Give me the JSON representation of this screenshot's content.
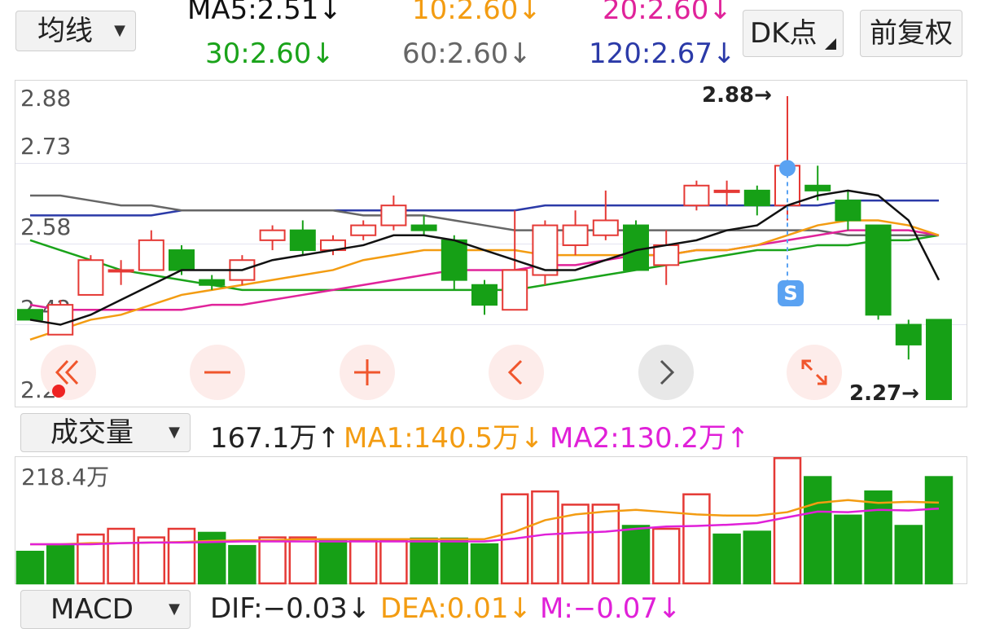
{
  "top": {
    "avg_select": "均线",
    "dk_button": "DK点",
    "fq_button": "前复权",
    "ma5": "MA5:2.51",
    "ma10": "10:2.60",
    "ma20": "20:2.60",
    "ma30": "30:2.60",
    "ma60": "60:2.60",
    "ma120": "120:2.67",
    "arrow_down": "↓"
  },
  "kline": {
    "y_labels": [
      "2.88",
      "2.73",
      "2.58",
      "2.42",
      "2.27"
    ],
    "high_label": "2.88→",
    "low_label": "→2.27",
    "low_value": "2.27",
    "low_arrow": "→",
    "signal_badge": "S"
  },
  "volume": {
    "select": "成交量",
    "value": "167.1万",
    "ma1": "MA1:140.5万",
    "ma2": "MA2:130.2万",
    "max_label": "218.4万",
    "arrow_up": "↑",
    "arrow_down": "↓"
  },
  "macd": {
    "select": "MACD",
    "dif": "DIF:−0.03",
    "dea": "DEA:0.01",
    "m": "M:−0.07",
    "arrow_down": "↓"
  },
  "colors": {
    "up": "#e53935",
    "down": "#16a016",
    "ma5": "#111111",
    "ma10": "#f39c12",
    "ma20": "#e0239a",
    "ma30": "#1aa31a",
    "ma60": "#666666",
    "ma120": "#2b3aa8",
    "ctrl_bg": "#fdecea",
    "ctrl_fg": "#f0552c"
  },
  "chart_data": [
    {
      "type": "candlestick",
      "ylim": [
        2.27,
        2.88
      ],
      "candles": [
        {
          "o": 2.45,
          "c": 2.43,
          "h": 2.45,
          "l": 2.43
        },
        {
          "o": 2.4,
          "c": 2.46,
          "h": 2.47,
          "l": 2.4
        },
        {
          "o": 2.48,
          "c": 2.55,
          "h": 2.56,
          "l": 2.48
        },
        {
          "o": 2.53,
          "c": 2.53,
          "h": 2.55,
          "l": 2.5
        },
        {
          "o": 2.53,
          "c": 2.59,
          "h": 2.61,
          "l": 2.53
        },
        {
          "o": 2.57,
          "c": 2.53,
          "h": 2.58,
          "l": 2.52
        },
        {
          "o": 2.51,
          "c": 2.5,
          "h": 2.52,
          "l": 2.49
        },
        {
          "o": 2.51,
          "c": 2.55,
          "h": 2.56,
          "l": 2.5
        },
        {
          "o": 2.59,
          "c": 2.61,
          "h": 2.62,
          "l": 2.57
        },
        {
          "o": 2.61,
          "c": 2.57,
          "h": 2.63,
          "l": 2.56
        },
        {
          "o": 2.57,
          "c": 2.59,
          "h": 2.6,
          "l": 2.56
        },
        {
          "o": 2.6,
          "c": 2.62,
          "h": 2.63,
          "l": 2.59
        },
        {
          "o": 2.62,
          "c": 2.66,
          "h": 2.68,
          "l": 2.61
        },
        {
          "o": 2.62,
          "c": 2.61,
          "h": 2.64,
          "l": 2.6
        },
        {
          "o": 2.59,
          "c": 2.51,
          "h": 2.6,
          "l": 2.49
        },
        {
          "o": 2.5,
          "c": 2.46,
          "h": 2.51,
          "l": 2.44
        },
        {
          "o": 2.45,
          "c": 2.53,
          "h": 2.65,
          "l": 2.45
        },
        {
          "o": 2.52,
          "c": 2.62,
          "h": 2.63,
          "l": 2.5
        },
        {
          "o": 2.58,
          "c": 2.62,
          "h": 2.65,
          "l": 2.56
        },
        {
          "o": 2.6,
          "c": 2.63,
          "h": 2.69,
          "l": 2.59
        },
        {
          "o": 2.62,
          "c": 2.53,
          "h": 2.63,
          "l": 2.53
        },
        {
          "o": 2.54,
          "c": 2.58,
          "h": 2.61,
          "l": 2.5
        },
        {
          "o": 2.66,
          "c": 2.7,
          "h": 2.71,
          "l": 2.65
        },
        {
          "o": 2.69,
          "c": 2.69,
          "h": 2.71,
          "l": 2.66
        },
        {
          "o": 2.69,
          "c": 2.66,
          "h": 2.7,
          "l": 2.64
        },
        {
          "o": 2.66,
          "c": 2.74,
          "h": 2.88,
          "l": 2.63
        },
        {
          "o": 2.7,
          "c": 2.69,
          "h": 2.74,
          "l": 2.67
        },
        {
          "o": 2.67,
          "c": 2.63,
          "h": 2.69,
          "l": 2.61
        },
        {
          "o": 2.62,
          "c": 2.44,
          "h": 2.62,
          "l": 2.43
        },
        {
          "o": 2.42,
          "c": 2.38,
          "h": 2.43,
          "l": 2.35
        },
        {
          "o": 2.43,
          "c": 2.27,
          "h": 2.43,
          "l": 2.27
        }
      ],
      "ma5": [
        2.43,
        2.42,
        2.44,
        2.47,
        2.5,
        2.53,
        2.53,
        2.53,
        2.55,
        2.56,
        2.57,
        2.58,
        2.6,
        2.6,
        2.59,
        2.57,
        2.55,
        2.53,
        2.53,
        2.55,
        2.57,
        2.58,
        2.59,
        2.61,
        2.62,
        2.66,
        2.68,
        2.69,
        2.68,
        2.63,
        2.51
      ],
      "ma10": [
        2.39,
        2.41,
        2.43,
        2.44,
        2.46,
        2.48,
        2.49,
        2.5,
        2.51,
        2.52,
        2.53,
        2.55,
        2.56,
        2.57,
        2.57,
        2.57,
        2.57,
        2.56,
        2.56,
        2.56,
        2.56,
        2.56,
        2.57,
        2.57,
        2.58,
        2.6,
        2.62,
        2.63,
        2.63,
        2.62,
        2.6
      ],
      "ma20": [
        2.46,
        2.45,
        2.45,
        2.45,
        2.45,
        2.45,
        2.46,
        2.46,
        2.47,
        2.48,
        2.49,
        2.5,
        2.51,
        2.52,
        2.53,
        2.53,
        2.53,
        2.54,
        2.54,
        2.55,
        2.56,
        2.56,
        2.57,
        2.57,
        2.58,
        2.59,
        2.6,
        2.61,
        2.61,
        2.61,
        2.6
      ],
      "ma30": [
        2.59,
        2.57,
        2.55,
        2.53,
        2.52,
        2.51,
        2.5,
        2.49,
        2.49,
        2.49,
        2.49,
        2.49,
        2.49,
        2.49,
        2.49,
        2.49,
        2.49,
        2.5,
        2.51,
        2.52,
        2.53,
        2.54,
        2.55,
        2.56,
        2.57,
        2.57,
        2.58,
        2.58,
        2.59,
        2.59,
        2.6
      ],
      "ma60": [
        2.68,
        2.68,
        2.67,
        2.66,
        2.66,
        2.65,
        2.65,
        2.65,
        2.65,
        2.65,
        2.65,
        2.64,
        2.64,
        2.64,
        2.63,
        2.62,
        2.61,
        2.61,
        2.61,
        2.61,
        2.61,
        2.61,
        2.61,
        2.61,
        2.61,
        2.61,
        2.61,
        2.6,
        2.6,
        2.6,
        2.6
      ],
      "ma120": [
        2.64,
        2.64,
        2.64,
        2.64,
        2.64,
        2.65,
        2.65,
        2.65,
        2.65,
        2.65,
        2.65,
        2.65,
        2.65,
        2.65,
        2.65,
        2.65,
        2.65,
        2.66,
        2.66,
        2.66,
        2.66,
        2.66,
        2.66,
        2.66,
        2.66,
        2.66,
        2.66,
        2.67,
        2.67,
        2.67,
        2.67
      ]
    },
    {
      "type": "bar",
      "title": "成交量",
      "unit": "万",
      "ylim": [
        0,
        218.4
      ],
      "values": [
        55,
        65,
        85,
        95,
        80,
        95,
        88,
        65,
        80,
        80,
        75,
        75,
        75,
        78,
        78,
        68,
        155,
        160,
        137,
        137,
        100,
        95,
        155,
        85,
        90,
        218,
        185,
        118,
        160,
        100,
        185
      ],
      "up": [
        false,
        false,
        true,
        true,
        true,
        true,
        false,
        false,
        true,
        true,
        false,
        true,
        true,
        false,
        false,
        false,
        true,
        true,
        true,
        true,
        false,
        true,
        true,
        false,
        false,
        true,
        false,
        false,
        false,
        false,
        false
      ],
      "ma1": [
        68,
        68,
        70,
        70,
        71,
        72,
        74,
        75,
        75,
        77,
        77,
        77,
        77,
        77,
        77,
        77,
        90,
        110,
        120,
        125,
        128,
        124,
        120,
        118,
        118,
        124,
        140,
        145,
        140,
        142,
        140.5
      ],
      "ma2": [
        68,
        68,
        68,
        70,
        71,
        71,
        72,
        73,
        73,
        73,
        73,
        73,
        73,
        73,
        73,
        73,
        78,
        85,
        88,
        90,
        95,
        99,
        100,
        102,
        105,
        115,
        125,
        124,
        128,
        127,
        130.2
      ]
    }
  ]
}
